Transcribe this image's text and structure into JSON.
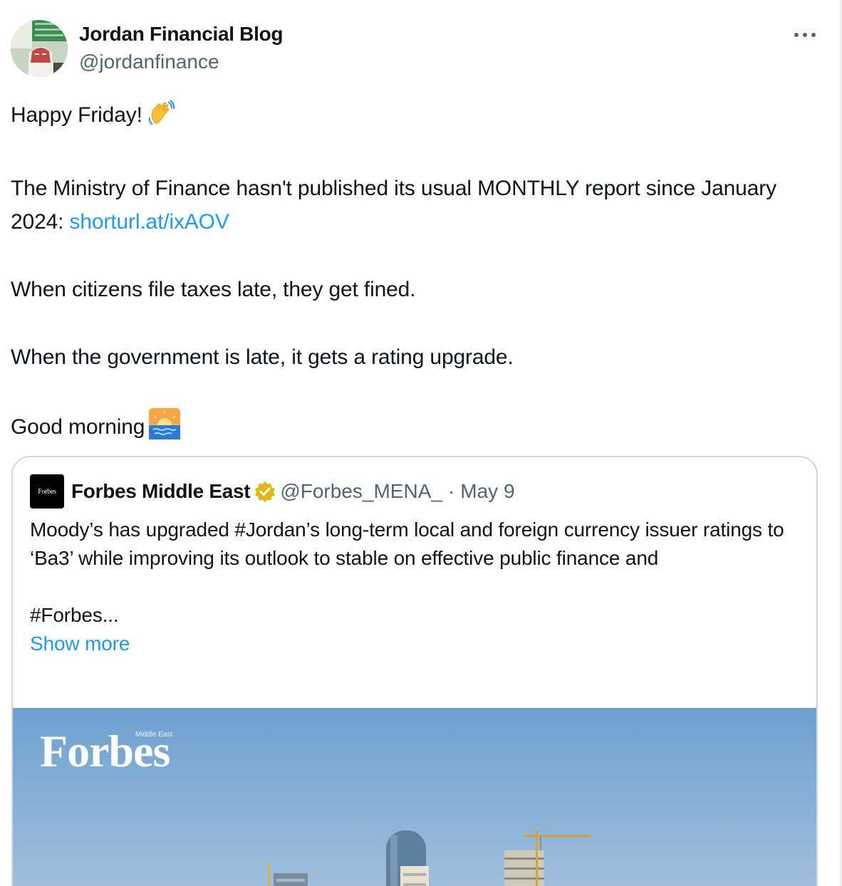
{
  "author": {
    "name": "Jordan Financial Blog",
    "handle": "@jordanfinance"
  },
  "tweet": {
    "line1": "Happy Friday!",
    "line1_emoji": "waving-hand-icon",
    "line2_text": "The Ministry of Finance hasn't published its usual MONTHLY report since January 2024: ",
    "line2_link": "shorturl.at/ixAOV",
    "line3": "When citizens file taxes late, they get fined.",
    "line4": "When the government is late, it gets a rating upgrade.",
    "line5": "Good morning",
    "line5_emoji": "sunrise-icon"
  },
  "quote": {
    "logo_text": "Forbes",
    "name": "Forbes Middle East",
    "handle": "@Forbes_MENA_",
    "separator": "·",
    "date": "May 9",
    "text_line1": "Moody’s has upgraded #Jordan’s long-term local and foreign currency issuer ratings to ‘Ba3’ while improving its outlook to stable on effective public finance and",
    "text_line2": "#Forbes...",
    "show_more": "Show more",
    "image": {
      "wordmark": "Forbes",
      "subtitle": "Middle East"
    }
  },
  "colors": {
    "link": "#1d9bf0",
    "secondary_text": "#536471",
    "border": "#cfd9de",
    "verified_badge": "#e2b719"
  }
}
